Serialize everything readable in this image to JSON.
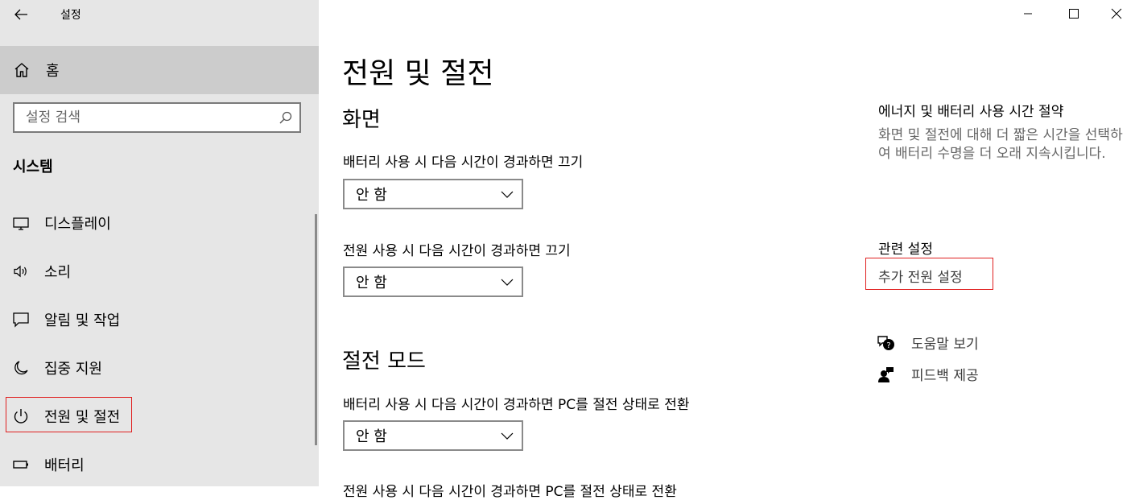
{
  "window": {
    "title": "설정"
  },
  "sidebar": {
    "home_label": "홈",
    "search_placeholder": "설정 검색",
    "section_title": "시스템",
    "items": [
      {
        "label": "디스플레이",
        "icon": "display-icon"
      },
      {
        "label": "소리",
        "icon": "speaker-icon"
      },
      {
        "label": "알림 및 작업",
        "icon": "notification-icon"
      },
      {
        "label": "집중 지원",
        "icon": "moon-icon"
      },
      {
        "label": "전원 및 절전",
        "icon": "power-icon"
      },
      {
        "label": "배터리",
        "icon": "battery-icon"
      }
    ]
  },
  "main": {
    "title": "전원 및 절전",
    "screen": {
      "title": "화면",
      "battery_label": "배터리 사용 시 다음 시간이 경과하면 끄기",
      "battery_value": "안 함",
      "plugged_label": "전원 사용 시 다음 시간이 경과하면 끄기",
      "plugged_value": "안 함"
    },
    "sleep": {
      "title": "절전 모드",
      "battery_label": "배터리 사용 시 다음 시간이 경과하면 PC를 절전 상태로 전환",
      "battery_value": "안 함",
      "plugged_label": "전원 사용 시 다음 시간이 경과하면 PC를 절전 상태로 전환"
    }
  },
  "right": {
    "energy_title": "에너지 및 배터리 사용 시간 절약",
    "energy_desc": "화면 및 절전에 대해 더 짧은 시간을 선택하여 배터리 수명을 더 오래 지속시킵니다.",
    "related_title": "관련 설정",
    "related_link": "추가 전원 설정",
    "help_label": "도움말 보기",
    "feedback_label": "피드백 제공"
  },
  "colors": {
    "sidebar_bg": "#e6e6e6",
    "selected_bg": "#cccccc",
    "highlight_border": "#e02020"
  }
}
